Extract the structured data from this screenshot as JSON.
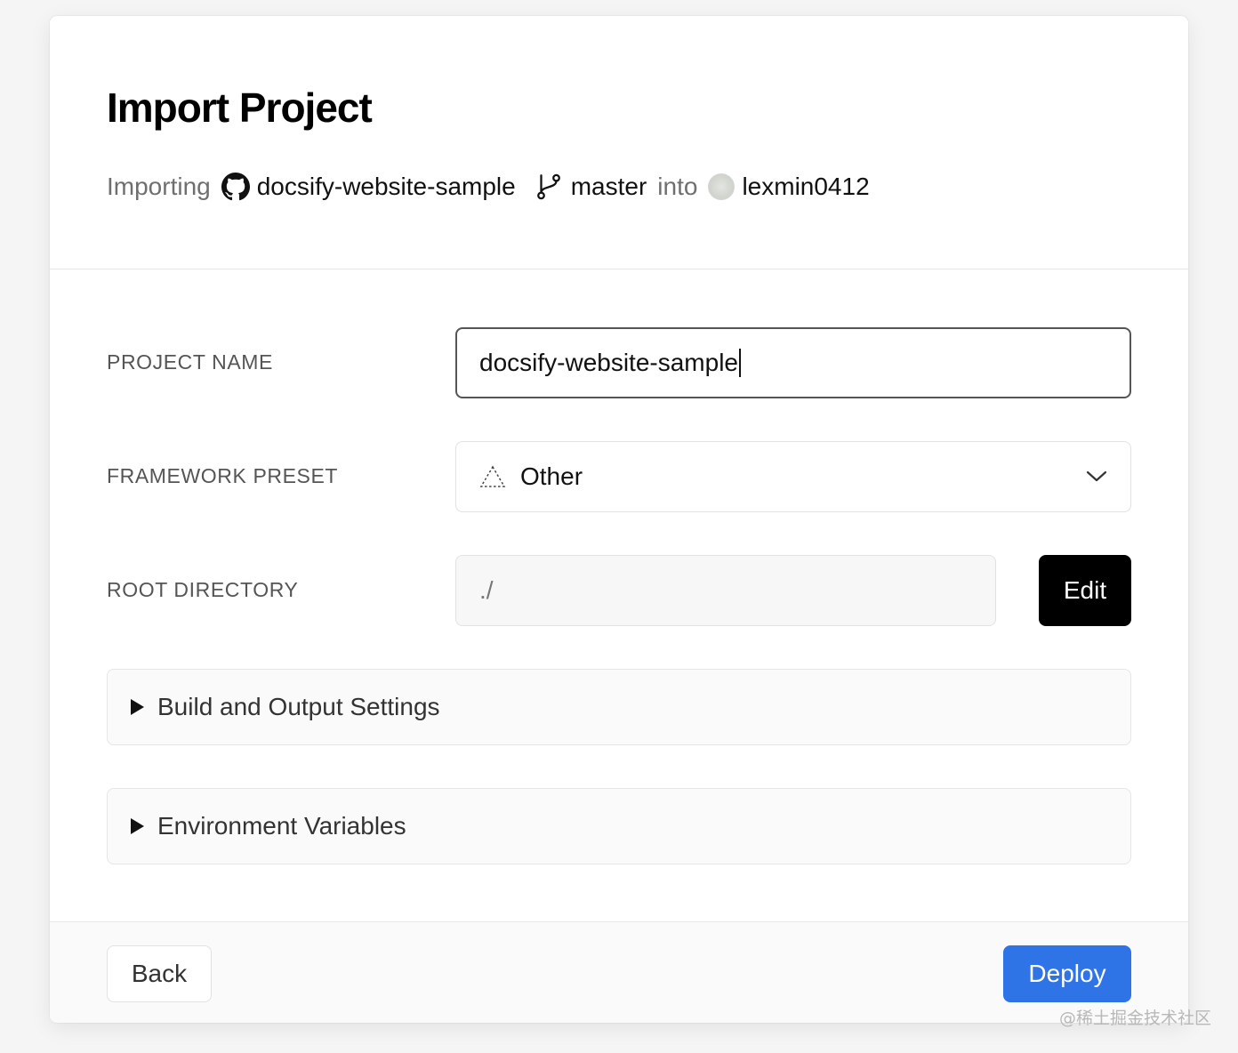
{
  "header": {
    "title": "Import Project",
    "importing_label": "Importing",
    "repo_name": "docsify-website-sample",
    "branch": "master",
    "into_label": "into",
    "account": "lexmin0412"
  },
  "form": {
    "project_name": {
      "label": "PROJECT NAME",
      "value": "docsify-website-sample"
    },
    "framework_preset": {
      "label": "FRAMEWORK PRESET",
      "value": "Other",
      "icon": "dashed-triangle-icon"
    },
    "root_directory": {
      "label": "ROOT DIRECTORY",
      "value": "./",
      "edit_label": "Edit"
    },
    "sections": [
      {
        "label": "Build and Output Settings"
      },
      {
        "label": "Environment Variables"
      }
    ]
  },
  "footer": {
    "back_label": "Back",
    "deploy_label": "Deploy"
  },
  "colors": {
    "deploy": "#2f74e6",
    "edit": "#000000"
  },
  "watermark": "@稀土掘金技术社区"
}
